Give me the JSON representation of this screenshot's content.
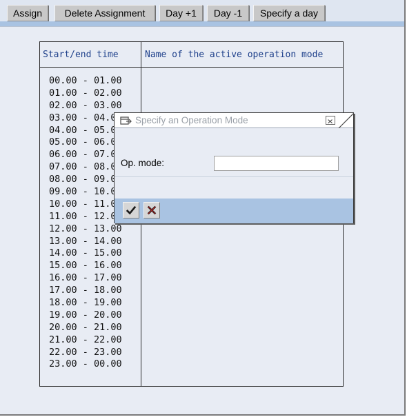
{
  "toolbar": {
    "buttons": [
      "Assign",
      "Delete Assignment",
      "Day +1",
      "Day -1",
      "Specify a day"
    ]
  },
  "grid": {
    "headers": [
      "Start/end time",
      "Name of the active operation mode"
    ],
    "times": [
      "00.00 - 01.00",
      "01.00 - 02.00",
      "02.00 - 03.00",
      "03.00 - 04.00",
      "04.00 - 05.00",
      "05.00 - 06.00",
      "06.00 - 07.00",
      "07.00 - 08.00",
      "08.00 - 09.00",
      "09.00 - 10.00",
      "10.00 - 11.00",
      "11.00 - 12.00",
      "12.00 - 13.00",
      "13.00 - 14.00",
      "14.00 - 15.00",
      "15.00 - 16.00",
      "16.00 - 17.00",
      "17.00 - 18.00",
      "18.00 - 19.00",
      "19.00 - 20.00",
      "20.00 - 21.00",
      "21.00 - 22.00",
      "22.00 - 23.00",
      "23.00 - 00.00"
    ]
  },
  "dialog": {
    "title": "Specify an Operation Mode",
    "op_mode_label": "Op. mode:",
    "op_mode_value": "",
    "icons": [
      "window-icon",
      "close-icon",
      "checkmark-icon",
      "cancel-icon"
    ]
  },
  "colors": {
    "background": "#e8ecf4",
    "stripe": "#a9c3e2",
    "header_text": "#1d3f8a",
    "button_face": "#c8c8c8"
  }
}
